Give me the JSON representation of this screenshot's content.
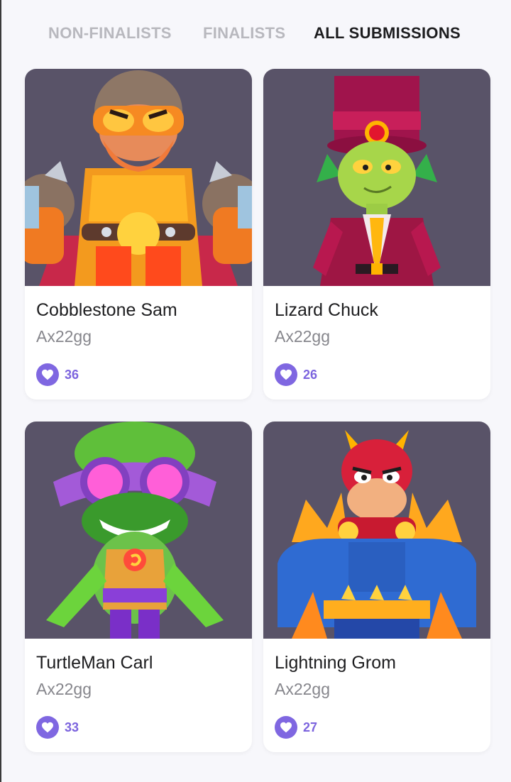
{
  "tabs": [
    {
      "label": "NON-FINALISTS",
      "active": false
    },
    {
      "label": "FINALISTS",
      "active": false
    },
    {
      "label": "ALL SUBMISSIONS",
      "active": true
    }
  ],
  "colors": {
    "accent": "#7f67e1",
    "card_art_background": "#595368",
    "active_tab": "#1c1c1e",
    "inactive_tab": "#b8b8be"
  },
  "submissions": [
    {
      "title": "Cobblestone Sam",
      "author": "Ax22gg",
      "likes": "36",
      "icon": "heart-icon"
    },
    {
      "title": "Lizard Chuck",
      "author": "Ax22gg",
      "likes": "26",
      "icon": "heart-icon"
    },
    {
      "title": "TurtleMan Carl",
      "author": "Ax22gg",
      "likes": "33",
      "icon": "heart-icon"
    },
    {
      "title": "Lightning Grom",
      "author": "Ax22gg",
      "likes": "27",
      "icon": "heart-icon"
    }
  ]
}
